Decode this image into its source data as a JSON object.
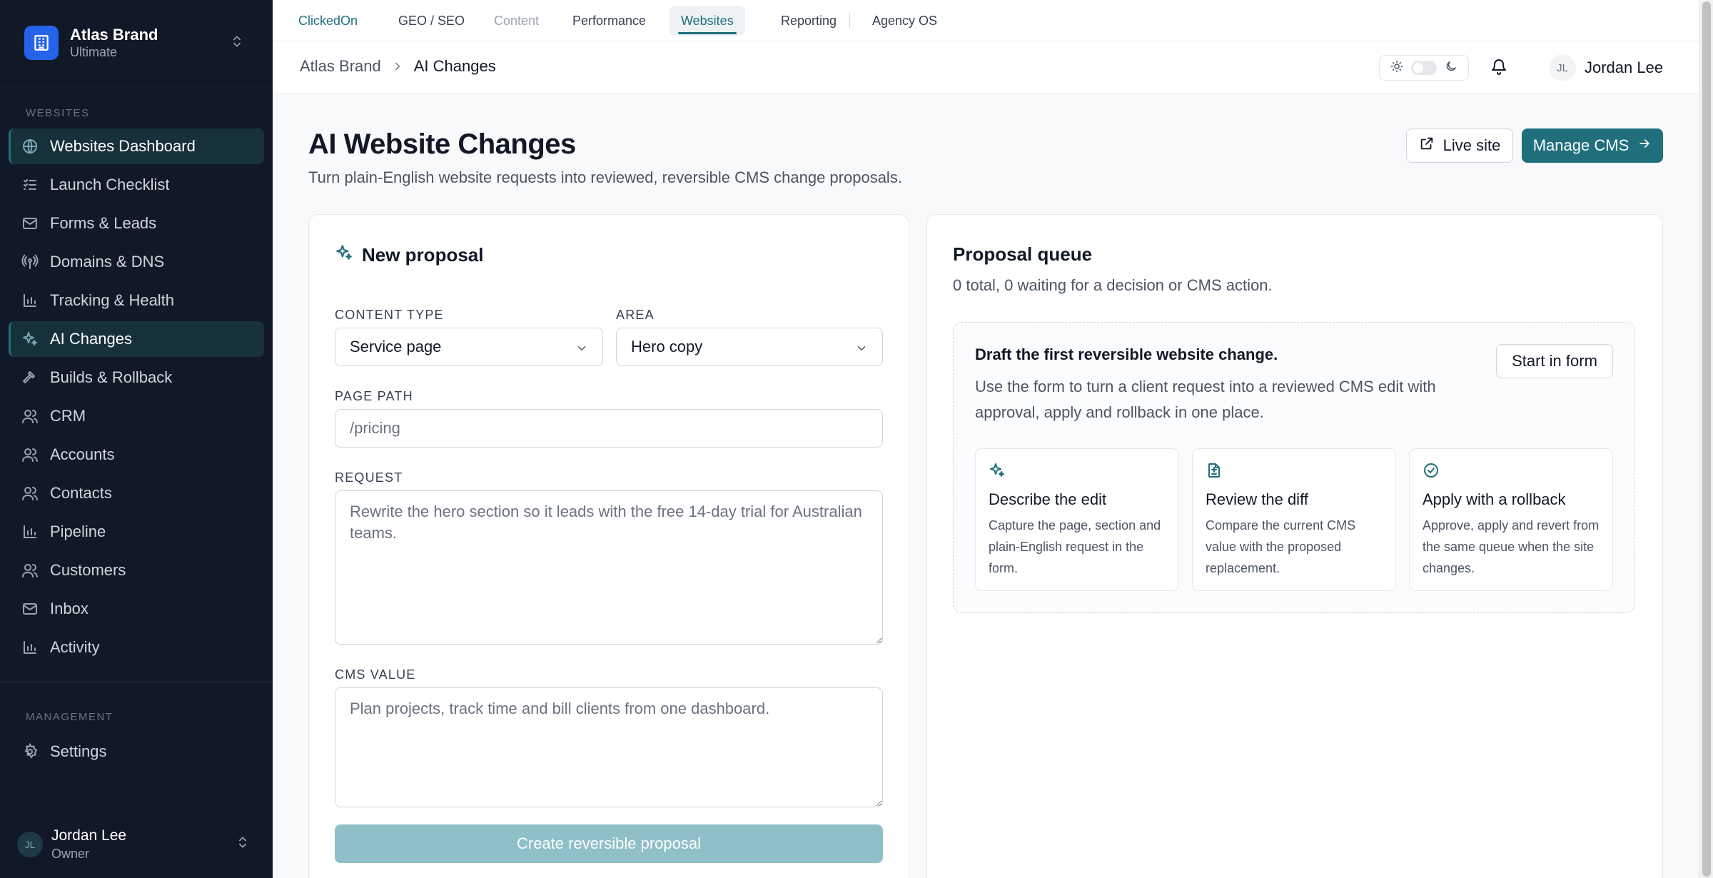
{
  "brand": {
    "name": "Atlas Brand",
    "plan": "Ultimate"
  },
  "sidebar": {
    "websites_label": "WEBSITES",
    "items": [
      {
        "label": "Websites Dashboard",
        "icon": "globe-icon",
        "active": true
      },
      {
        "label": "Launch Checklist",
        "icon": "checklist-icon"
      },
      {
        "label": "Forms & Leads",
        "icon": "mail-icon"
      },
      {
        "label": "Domains & DNS",
        "icon": "radio-tower-icon"
      },
      {
        "label": "Tracking & Health",
        "icon": "bar-chart-icon"
      },
      {
        "label": "AI Changes",
        "icon": "sparkles-icon",
        "active": true
      },
      {
        "label": "Builds & Rollback",
        "icon": "hammer-icon"
      },
      {
        "label": "CRM",
        "icon": "users-icon"
      },
      {
        "label": "Accounts",
        "icon": "users-icon"
      },
      {
        "label": "Contacts",
        "icon": "users-icon"
      },
      {
        "label": "Pipeline",
        "icon": "bar-chart-icon"
      },
      {
        "label": "Customers",
        "icon": "users-icon"
      },
      {
        "label": "Inbox",
        "icon": "mail-icon"
      },
      {
        "label": "Activity",
        "icon": "bar-chart-icon"
      }
    ],
    "management_label": "MANAGEMENT",
    "settings_label": "Settings",
    "user": {
      "initials": "JL",
      "name": "Jordan Lee",
      "role": "Owner"
    }
  },
  "topnav": {
    "items": [
      "ClickedOn",
      "GEO / SEO",
      "Content",
      "Performance",
      "Websites",
      "Reporting",
      "Agency OS"
    ],
    "active": "Websites"
  },
  "breadcrumb": {
    "root": "Atlas Brand",
    "current": "AI Changes"
  },
  "header_user": {
    "initials": "JL",
    "name": "Jordan Lee"
  },
  "page": {
    "title": "AI Website Changes",
    "subtitle": "Turn plain-English website requests into reviewed, reversible CMS change proposals.",
    "live_site_label": "Live site",
    "manage_cms_label": "Manage CMS"
  },
  "proposal_form": {
    "title": "New proposal",
    "content_type_label": "CONTENT TYPE",
    "content_type_value": "Service page",
    "area_label": "AREA",
    "area_value": "Hero copy",
    "page_path_label": "PAGE PATH",
    "page_path_placeholder": "/pricing",
    "request_label": "REQUEST",
    "request_placeholder": "Rewrite the hero section so it leads with the free 14-day trial for Australian teams.",
    "cms_value_label": "CMS VALUE",
    "cms_value_placeholder": "Plan projects, track time and bill clients from one dashboard.",
    "submit_label": "Create reversible proposal"
  },
  "queue": {
    "title": "Proposal queue",
    "summary": "0 total, 0 waiting for a decision or CMS action.",
    "empty_title": "Draft the first reversible website change.",
    "empty_body": "Use the form to turn a client request into a reviewed CMS edit with approval, apply and rollback in one place.",
    "start_label": "Start in form",
    "steps": [
      {
        "title": "Describe the edit",
        "desc": "Capture the page, section and plain-English request in the form.",
        "icon": "sparkles-icon"
      },
      {
        "title": "Review the diff",
        "desc": "Compare the current CMS value with the proposed replacement.",
        "icon": "file-diff-icon"
      },
      {
        "title": "Apply with a rollback",
        "desc": "Approve, apply and revert from the same queue when the site changes.",
        "icon": "check-circle-icon"
      }
    ]
  },
  "colors": {
    "accent": "#1f6f7d",
    "sidebar_bg": "#111827",
    "brand_blue": "#2563eb",
    "submit_disabled": "#8fbfc7"
  }
}
